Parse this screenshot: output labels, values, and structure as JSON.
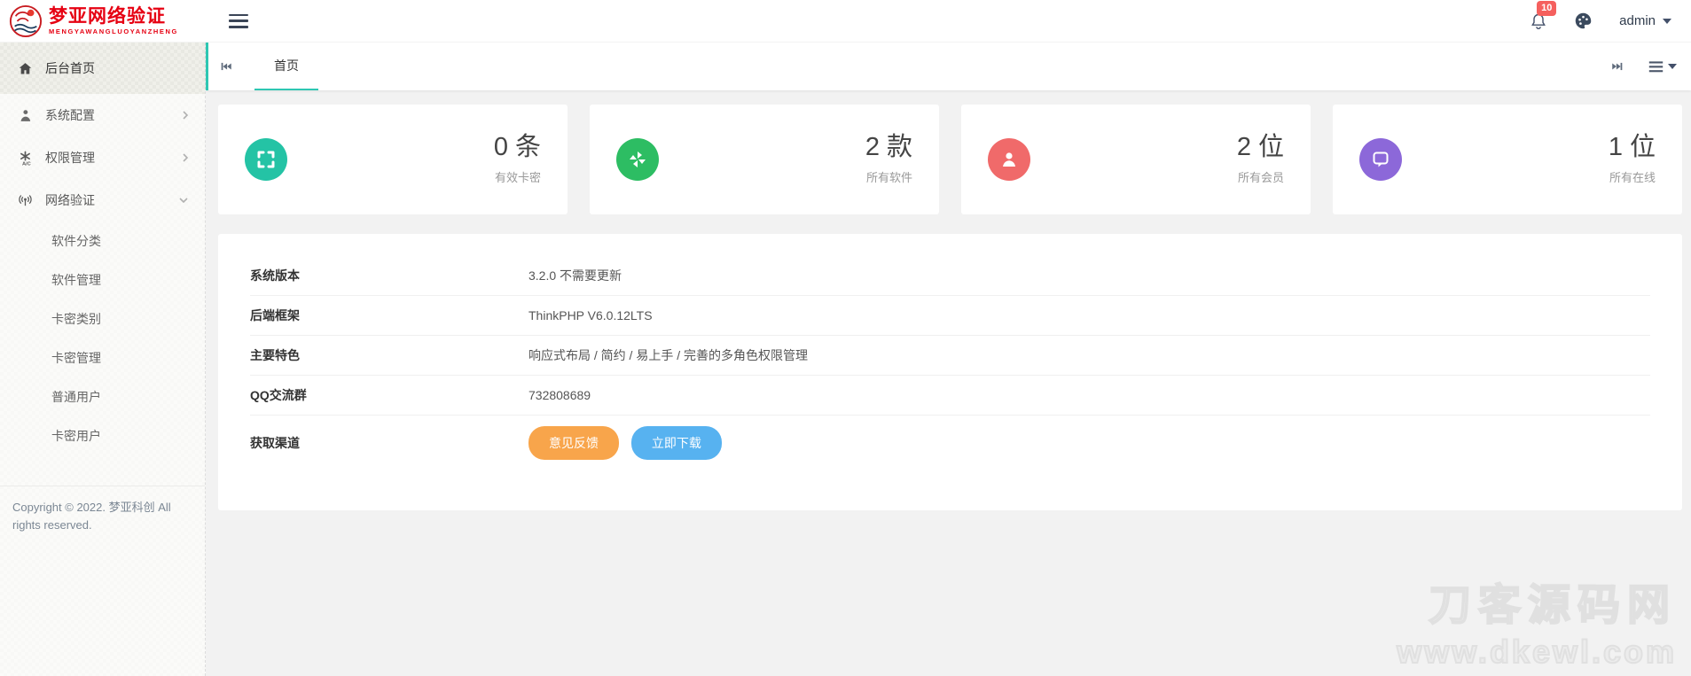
{
  "header": {
    "logo": {
      "title": "梦亚网络验证",
      "subtitle": "MENGYAWANGLUOYANZHENG",
      "brand_color": "#e60012"
    },
    "notification_count": "10",
    "username": "admin"
  },
  "sidebar": {
    "items": [
      {
        "label": "后台首页",
        "icon": "home-icon",
        "active": true
      },
      {
        "label": "系统配置",
        "icon": "user-icon",
        "chevron": "right"
      },
      {
        "label": "权限管理",
        "icon": "auth-icon",
        "chevron": "right"
      },
      {
        "label": "网络验证",
        "icon": "network-icon",
        "chevron": "down",
        "children": [
          "软件分类",
          "软件管理",
          "卡密类别",
          "卡密管理",
          "普通用户",
          "卡密用户"
        ]
      }
    ],
    "copyright": "Copyright © 2022. 梦亚科创 All rights reserved."
  },
  "tabbar": {
    "accent_color": "#2ec7b2",
    "tabs": [
      {
        "label": "首页",
        "active": true
      }
    ]
  },
  "stats": [
    {
      "value": "0 条",
      "label": "有效卡密",
      "color": "#24c3a5",
      "icon": "corners-icon"
    },
    {
      "value": "2 款",
      "label": "所有软件",
      "color": "#2dbd63",
      "icon": "pinwheel-icon"
    },
    {
      "value": "2 位",
      "label": "所有会员",
      "color": "#f06a6a",
      "icon": "member-icon"
    },
    {
      "value": "1 位",
      "label": "所有在线",
      "color": "#8c68d9",
      "icon": "chat-bubble-icon"
    }
  ],
  "info": {
    "rows": [
      {
        "label": "系统版本",
        "value": "3.2.0 不需要更新"
      },
      {
        "label": "后端框架",
        "value": "ThinkPHP V6.0.12LTS"
      },
      {
        "label": "主要特色",
        "value": "响应式布局 / 简约 / 易上手 / 完善的多角色权限管理"
      },
      {
        "label": "QQ交流群",
        "value": "732808689"
      },
      {
        "label": "获取渠道"
      }
    ],
    "buttons": [
      {
        "label": "意见反馈",
        "color": "#f8a54b"
      },
      {
        "label": "立即下载",
        "color": "#57b2f0"
      }
    ]
  },
  "watermark": {
    "line1": "刀客源码网",
    "line2": "www.dkewl.com"
  }
}
